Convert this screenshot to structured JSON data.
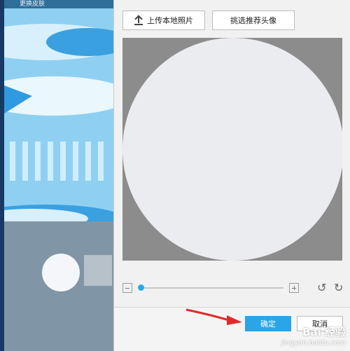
{
  "preview": {
    "title": "更换皮肤"
  },
  "toolbar": {
    "upload_label": "上传本地照片",
    "pick_label": "挑选推荐头像"
  },
  "zoom": {
    "level_fraction": 0.0
  },
  "footer": {
    "ok_label": "确定",
    "cancel_label": "取消"
  },
  "watermark": {
    "logo_text": "Bai 经验",
    "url": "jingyan.baidu.com"
  },
  "colors": {
    "accent": "#2aa5e8",
    "arrow": "#e02a2a",
    "crop_background": "#8c8c8c"
  },
  "icons": [
    "upload-icon",
    "zoom-minus-icon",
    "zoom-plus-icon",
    "rotate-left-icon",
    "rotate-right-icon",
    "pointer-arrow-icon"
  ]
}
